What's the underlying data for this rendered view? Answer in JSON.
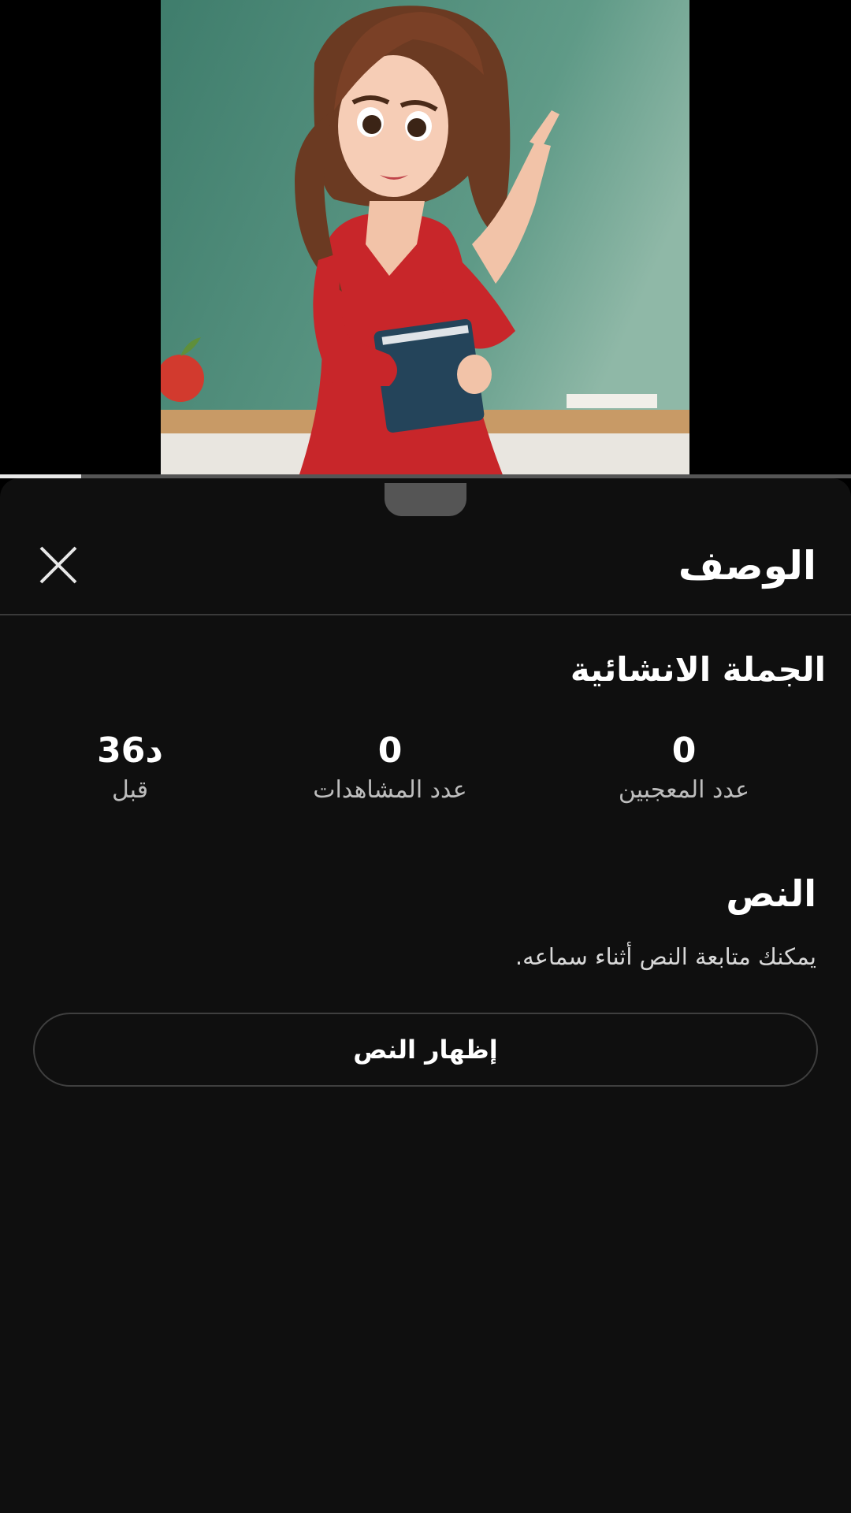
{
  "video": {
    "thumbnail_icon": "teacher-cartoon-illustration",
    "progress_fraction": 0.095
  },
  "sheet": {
    "title": "الوصف",
    "close_icon": "close-icon"
  },
  "details": {
    "video_title": "الجملة الانشائية",
    "stats": [
      {
        "value": "0",
        "label": "عدد المعجبين"
      },
      {
        "value": "0",
        "label": "عدد المشاهدات"
      },
      {
        "value": "36د",
        "label": "قبل"
      }
    ]
  },
  "transcript": {
    "title": "النص",
    "description": "يمكنك متابعة النص أثناء سماعه.",
    "show_button_label": "إظهار النص"
  },
  "colors": {
    "sheet_background": "#0f0f0f",
    "progress_fill": "#e8e8e8"
  }
}
